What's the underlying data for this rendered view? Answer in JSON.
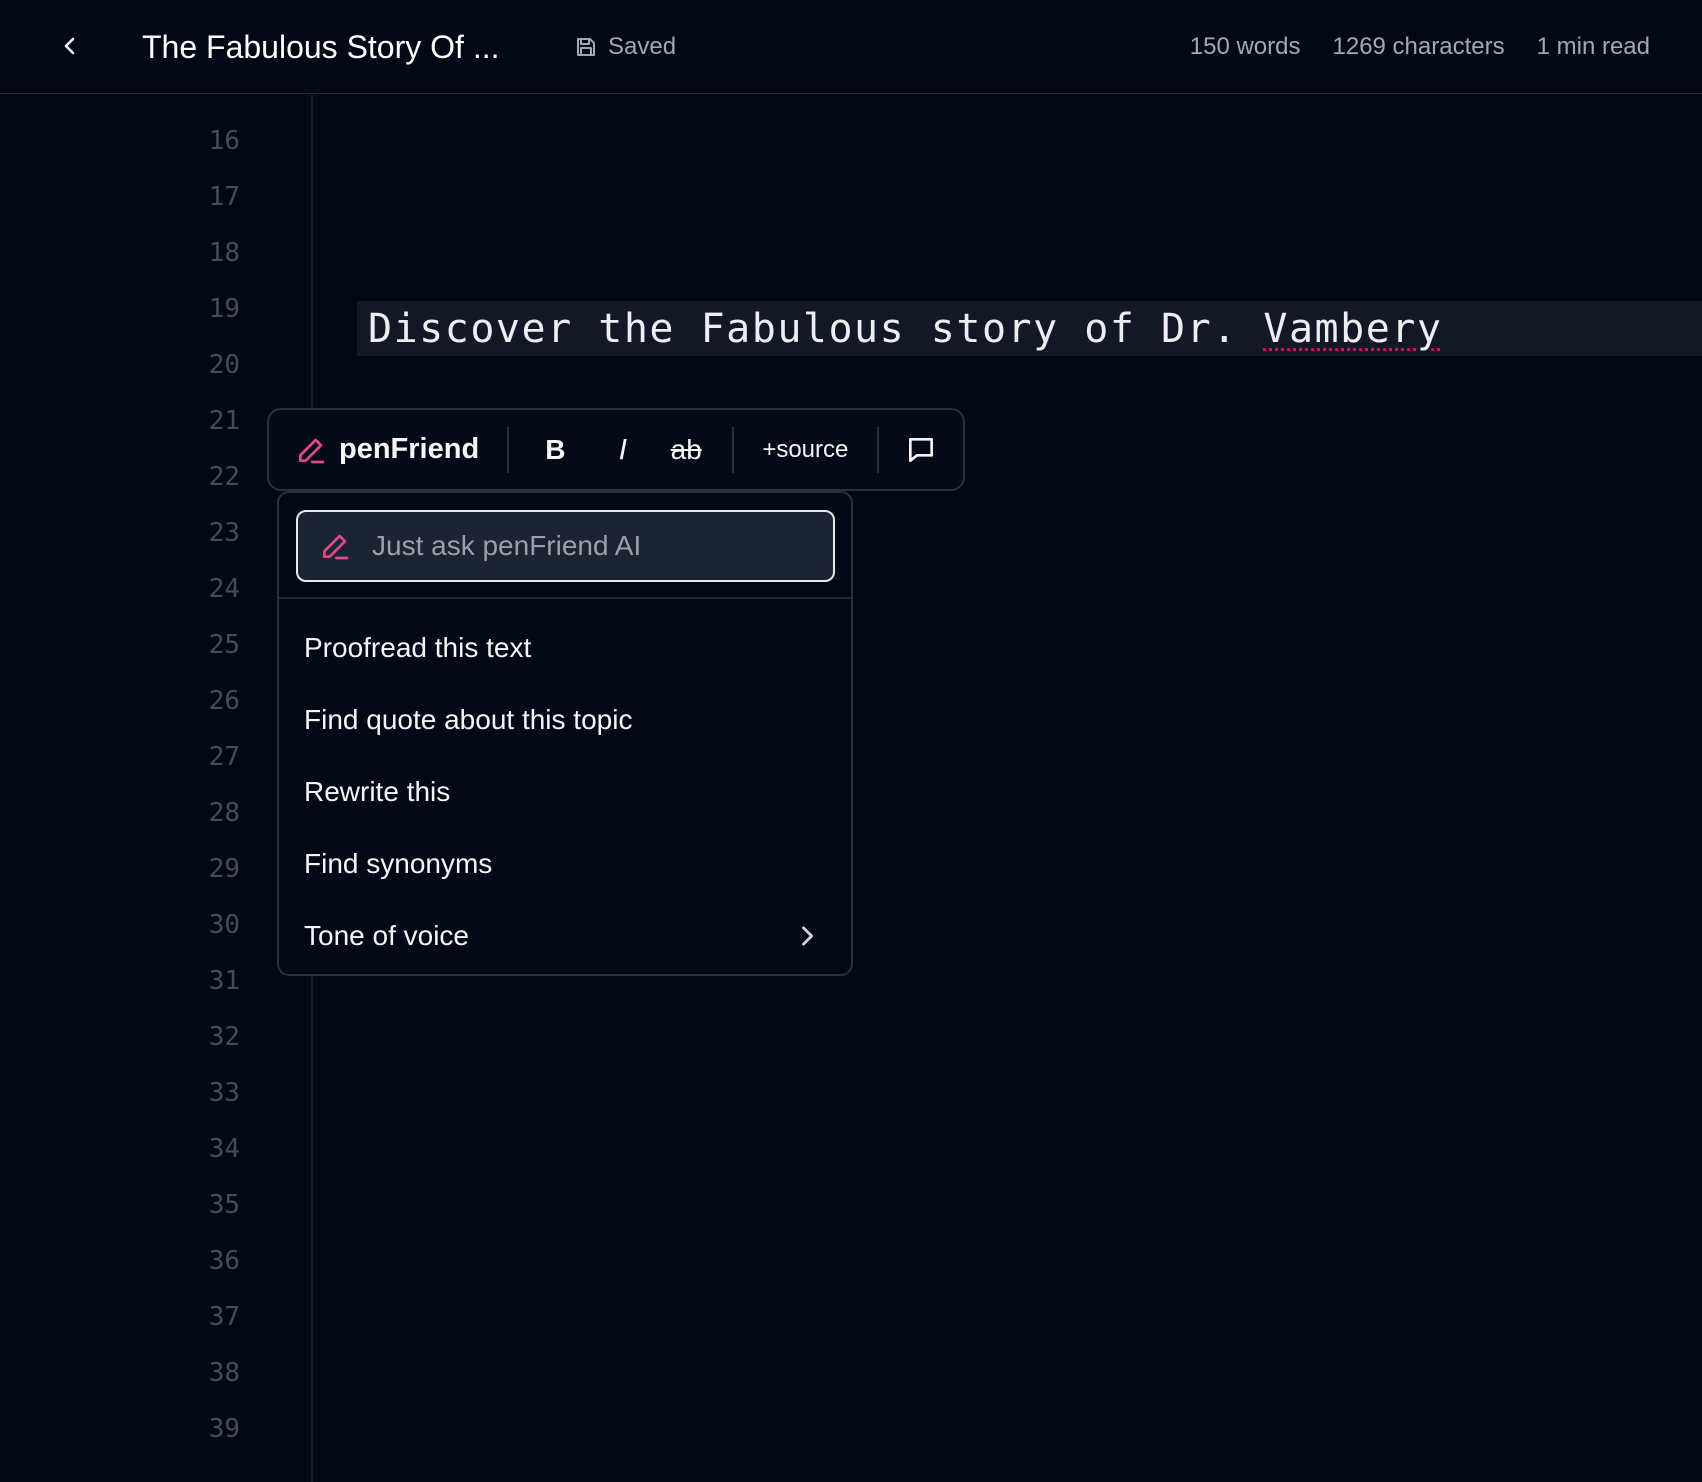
{
  "header": {
    "title": "The Fabulous Story Of ...",
    "saved_label": "Saved",
    "words": "150 words",
    "characters": "1269 characters",
    "read_time": "1 min read"
  },
  "gutter": {
    "line_numbers": [
      "16",
      "17",
      "18",
      "19",
      "20",
      "21",
      "22",
      "23",
      "24",
      "25",
      "26",
      "27",
      "28",
      "29",
      "30",
      "31",
      "32",
      "33",
      "34",
      "35",
      "36",
      "37",
      "38",
      "39"
    ]
  },
  "editor": {
    "text_before": "Discover the Fabulous story of Dr. ",
    "misspelled_word": "Vambery"
  },
  "toolbar": {
    "brand_label": "penFriend",
    "bold_label": "B",
    "italic_label": "I",
    "strike_label": "ab",
    "source_label": "+source"
  },
  "ai_menu": {
    "input_placeholder": "Just ask penFriend AI",
    "input_value": "",
    "items": [
      {
        "label": "Proofread this text"
      },
      {
        "label": "Find quote about this topic"
      },
      {
        "label": "Rewrite this"
      },
      {
        "label": "Find synonyms"
      },
      {
        "label": "Tone of voice"
      }
    ]
  },
  "colors": {
    "background": "#030816",
    "accent_pink": "#e04a8a",
    "line_highlight": "#131826",
    "input_background": "#1c2333"
  },
  "icons": {
    "back": "chevron-left-icon",
    "saved": "floppy-disk-icon",
    "brand": "pen-icon",
    "comment": "speech-bubble-icon",
    "submenu": "chevron-right-icon"
  }
}
